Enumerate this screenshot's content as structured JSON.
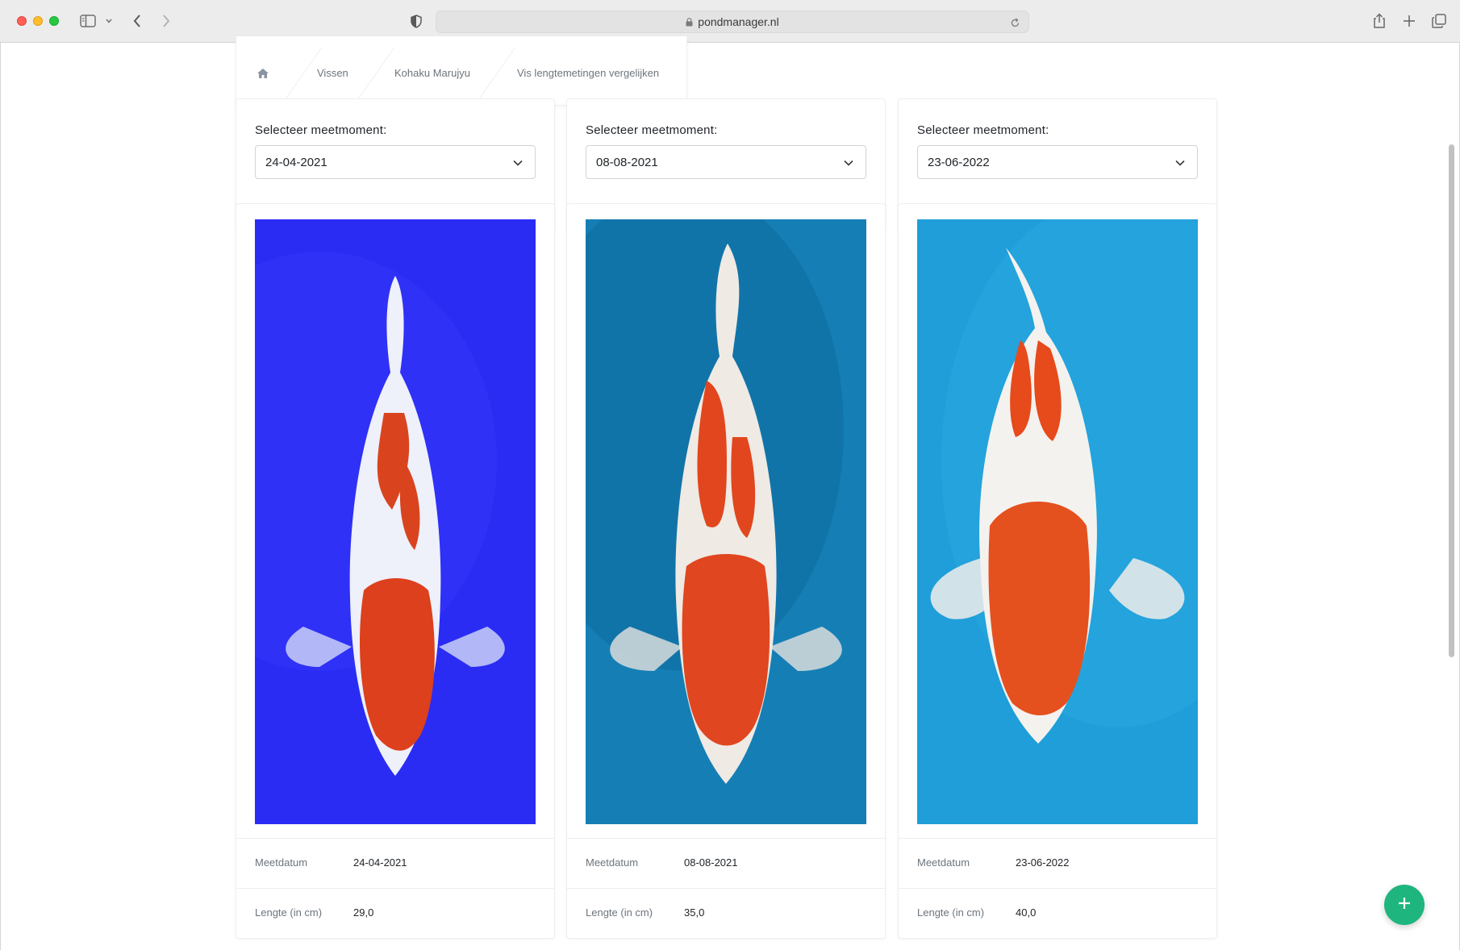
{
  "browser": {
    "url": "pondmanager.nl"
  },
  "breadcrumb": {
    "items": [
      "Vissen",
      "Kohaku Marujyu",
      "Vis lengtemetingen vergelijken"
    ]
  },
  "selectors": [
    {
      "label": "Selecteer meetmoment:",
      "value": "24-04-2021"
    },
    {
      "label": "Selecteer meetmoment:",
      "value": "08-08-2021"
    },
    {
      "label": "Selecteer meetmoment:",
      "value": "23-06-2022"
    }
  ],
  "measurements": [
    {
      "date_label": "Meetdatum",
      "date": "24-04-2021",
      "length_label": "Lengte (in cm)",
      "length": "29,0",
      "bg_color": "#2a2cf4"
    },
    {
      "date_label": "Meetdatum",
      "date": "08-08-2021",
      "length_label": "Lengte (in cm)",
      "length": "35,0",
      "bg_color": "#157fb5"
    },
    {
      "date_label": "Meetdatum",
      "date": "23-06-2022",
      "length_label": "Lengte (in cm)",
      "length": "40,0",
      "bg_color": "#1f9ed9"
    }
  ],
  "colors": {
    "accent": "#1fb57e",
    "koi_red": "#e2441e",
    "koi_white": "#f3f1ee"
  }
}
